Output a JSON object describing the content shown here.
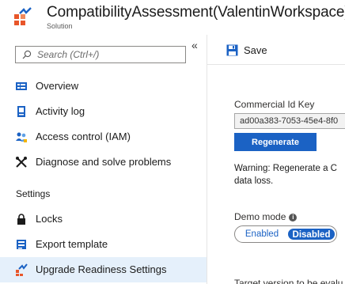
{
  "header": {
    "title": "CompatibilityAssessment(ValentinWorkspace)",
    "subtitle": "Solution",
    "logo_icon": "solution-analytics-icon"
  },
  "sidebar": {
    "search_placeholder": "Search (Ctrl+/)",
    "collapse_label": "«",
    "items": [
      {
        "label": "Overview",
        "icon": "overview-icon"
      },
      {
        "label": "Activity log",
        "icon": "activity-log-icon"
      },
      {
        "label": "Access control (IAM)",
        "icon": "iam-icon"
      },
      {
        "label": "Diagnose and solve problems",
        "icon": "wrench-icon"
      }
    ],
    "section_settings": "Settings",
    "settings_items": [
      {
        "label": "Locks",
        "icon": "lock-icon"
      },
      {
        "label": "Export template",
        "icon": "export-template-icon"
      },
      {
        "label": "Upgrade Readiness Settings",
        "icon": "upgrade-readiness-icon",
        "active": true
      }
    ]
  },
  "toolbar": {
    "save_label": "Save"
  },
  "main": {
    "commercial_id_label": "Commercial Id Key",
    "commercial_id_value": "ad00a383-7053-45e4-8f0",
    "regenerate_label": "Regenerate",
    "warning_line1": "Warning: Regenerate a C",
    "warning_line2": "data loss.",
    "demo_mode_label": "Demo mode",
    "demo_mode_options": [
      "Enabled",
      "Disabled"
    ],
    "demo_mode_selected": "Disabled",
    "target_version_label": "Target version to be evalu"
  },
  "colors": {
    "accent": "#1b62c4",
    "active_nav_bg": "#e5f0fb",
    "logo_orange": "#e8562a"
  }
}
